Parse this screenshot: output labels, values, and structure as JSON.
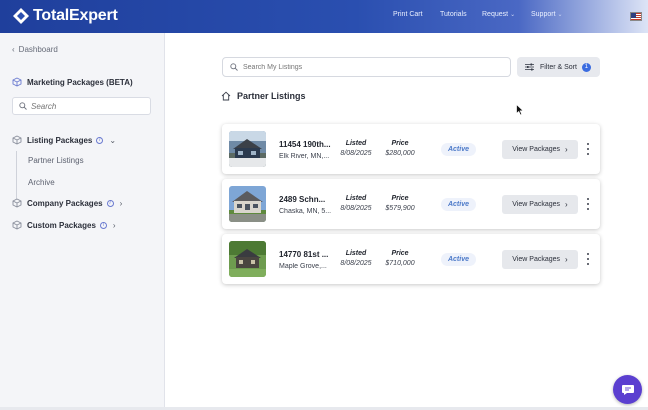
{
  "header": {
    "brand": "TotalExpert",
    "nav": [
      {
        "label": "Print Cart",
        "dropdown": false
      },
      {
        "label": "Tutorials",
        "dropdown": false
      },
      {
        "label": "Request",
        "dropdown": true
      },
      {
        "label": "Support",
        "dropdown": true
      }
    ],
    "flag_icon": "us-flag-icon"
  },
  "sidebar": {
    "back_label": "Dashboard",
    "section_title": "Marketing Packages (BETA)",
    "search_placeholder": "Search",
    "groups": [
      {
        "label": "Listing Packages",
        "expanded": true,
        "children": [
          "Partner Listings",
          "Archive"
        ]
      },
      {
        "label": "Company Packages",
        "expanded": false
      },
      {
        "label": "Custom Packages",
        "expanded": false
      }
    ]
  },
  "main": {
    "search_placeholder": "Search My Listings",
    "filter_label": "Filter & Sort",
    "filter_count": "1",
    "page_title": "Partner Listings",
    "listed_label": "Listed",
    "price_label": "Price",
    "view_label": "View Packages",
    "listings": [
      {
        "address": "11454 190th...",
        "city": "Elk River, MN,...",
        "listed": "8/08/2025",
        "price": "$280,000",
        "status": "Active"
      },
      {
        "address": "2489 Schn...",
        "city": "Chaska, MN, 5...",
        "listed": "8/08/2025",
        "price": "$579,900",
        "status": "Active"
      },
      {
        "address": "14770 81st ...",
        "city": "Maple Grove,...",
        "listed": "8/08/2025",
        "price": "$710,000",
        "status": "Active"
      }
    ]
  },
  "colors": {
    "header_start": "#1f3f9c",
    "accent": "#3b6ce0",
    "status_text": "#4a78c8",
    "chat": "#5b3fd0"
  }
}
